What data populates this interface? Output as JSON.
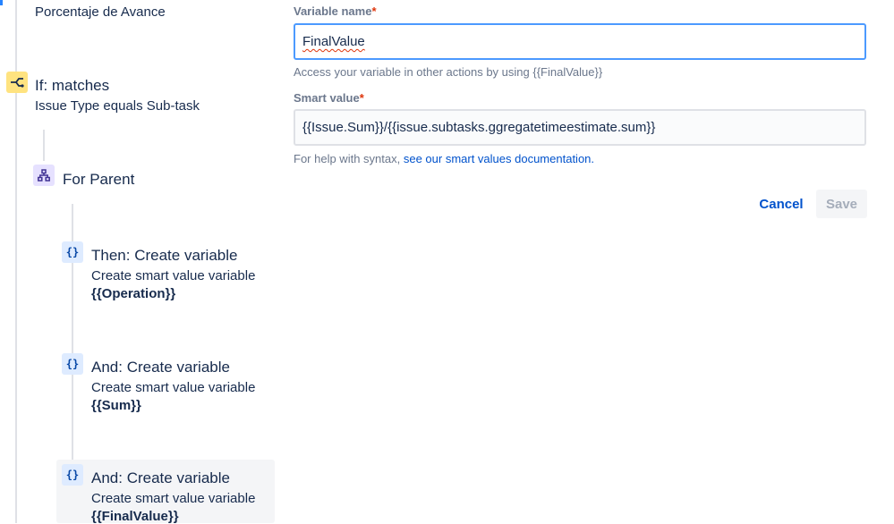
{
  "left": {
    "top_text": "Porcentaje de Avance",
    "condition": {
      "title": "If: matches",
      "subtitle": "Issue Type equals Sub-task",
      "icon": "branch-icon"
    },
    "branch": {
      "title": "For Parent",
      "icon": "hierarchy-icon"
    },
    "actions": [
      {
        "title": "Then: Create variable",
        "subtitle": "Create smart value variable",
        "var": "{{Operation}}",
        "icon": "braces-icon"
      },
      {
        "title": "And: Create variable",
        "subtitle": "Create smart value variable",
        "var": "{{Sum}}",
        "icon": "braces-icon"
      },
      {
        "title": "And: Create variable",
        "subtitle": "Create smart value variable",
        "var": "{{FinalValue}}",
        "icon": "braces-icon"
      }
    ]
  },
  "form": {
    "variable_name": {
      "label": "Variable name",
      "required_mark": "*",
      "value": "FinalValue",
      "help": "Access your variable in other actions by using {{FinalValue}}"
    },
    "smart_value": {
      "label": "Smart value",
      "required_mark": "*",
      "value": "{{Issue.Sum}}/{{issue.subtasks.ggregatetimeestimate.sum}}",
      "help_prefix": "For help with syntax,",
      "help_link": "see our smart values documentation."
    },
    "cancel_label": "Cancel",
    "save_label": "Save"
  },
  "colors": {
    "accent": "#0052cc",
    "focus_border": "#4c9aff",
    "condition_icon_bg": "#ffe380",
    "branch_icon_bg": "#e6e1ff",
    "action_icon_bg": "#deebff"
  }
}
